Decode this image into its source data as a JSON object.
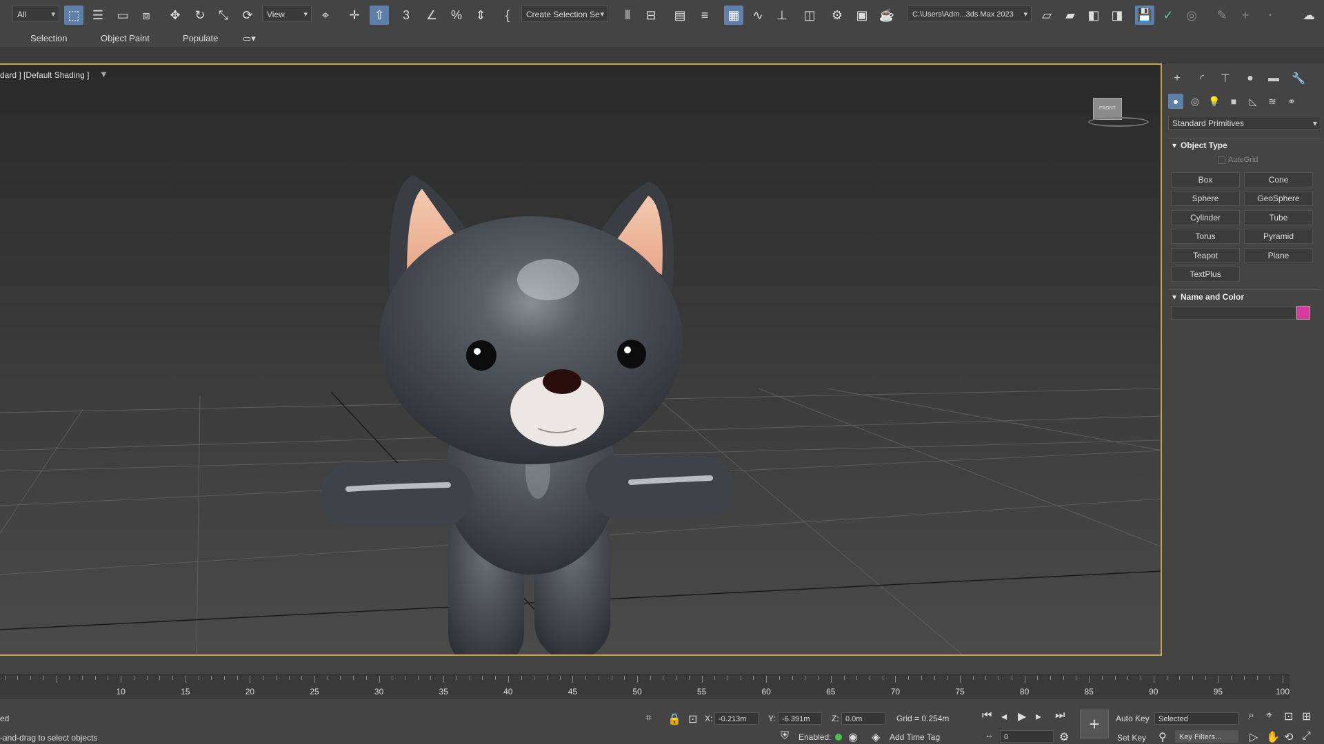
{
  "toolbar": {
    "selection_filter": "All",
    "reference_coord": "View",
    "named_selection": "Create Selection Se",
    "project_path": "C:\\Users\\Adm...3ds Max 2023"
  },
  "ribbon": {
    "tabs": [
      "Selection",
      "Object Paint",
      "Populate"
    ]
  },
  "viewport": {
    "label": "dard ] [Default Shading ]",
    "viewcube_label": "FRONT"
  },
  "command_panel": {
    "category": "Standard Primitives",
    "object_type_title": "Object Type",
    "autogrid": "AutoGrid",
    "buttons": [
      "Box",
      "Cone",
      "Sphere",
      "GeoSphere",
      "Cylinder",
      "Tube",
      "Torus",
      "Pyramid",
      "Teapot",
      "Plane",
      "TextPlus"
    ],
    "name_color_title": "Name and Color",
    "object_name": "",
    "color": "#d63a9a"
  },
  "timeline": {
    "ticks": [
      "10",
      "15",
      "20",
      "25",
      "30",
      "35",
      "40",
      "45",
      "50",
      "55",
      "60",
      "65",
      "70",
      "75",
      "80",
      "85",
      "90",
      "95",
      "100"
    ]
  },
  "status": {
    "line1": "ed",
    "line2": "-and-drag to select objects",
    "x_label": "X:",
    "x_value": "-0.213m",
    "y_label": "Y:",
    "y_value": "-6.391m",
    "z_label": "Z:",
    "z_value": "0.0m",
    "grid": "Grid = 0.254m",
    "enabled": "Enabled:",
    "add_time_tag": "Add Time Tag",
    "auto_key": "Auto Key",
    "set_key": "Set Key",
    "key_mode": "Selected",
    "key_filters": "Key Filters...",
    "frame": "0"
  },
  "colors": {
    "accent": "#5d7fa8",
    "viewport_border": "#c8a44a"
  }
}
